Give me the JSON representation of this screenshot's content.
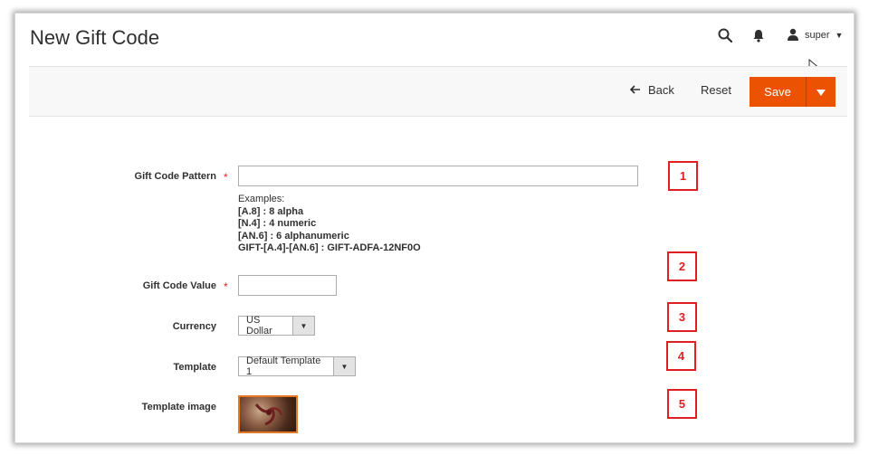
{
  "header": {
    "title": "New Gift Code",
    "user_name": "super",
    "icons": [
      "search-icon",
      "bell-icon",
      "user-icon",
      "chevron-down-icon"
    ]
  },
  "actions": {
    "back_label": "Back",
    "reset_label": "Reset",
    "save_label": "Save"
  },
  "form": {
    "pattern": {
      "label": "Gift Code Pattern",
      "required_mark": "*",
      "value": "",
      "examples_title": "Examples:",
      "examples": [
        "[A.8] : 8 alpha",
        "[N.4] : 4 numeric",
        "[AN.6] : 6 alphanumeric",
        "GIFT-[A.4]-[AN.6] : GIFT-ADFA-12NF0O"
      ]
    },
    "value": {
      "label": "Gift Code Value",
      "required_mark": "*",
      "value": ""
    },
    "currency": {
      "label": "Currency",
      "selected": "US Dollar"
    },
    "template": {
      "label": "Template",
      "selected": "Default Template 1"
    },
    "template_image": {
      "label": "Template image"
    }
  },
  "callouts": [
    "1",
    "2",
    "3",
    "4",
    "5"
  ],
  "colors": {
    "accent": "#eb5202",
    "required": "#e22626",
    "callout": "#e02020"
  }
}
